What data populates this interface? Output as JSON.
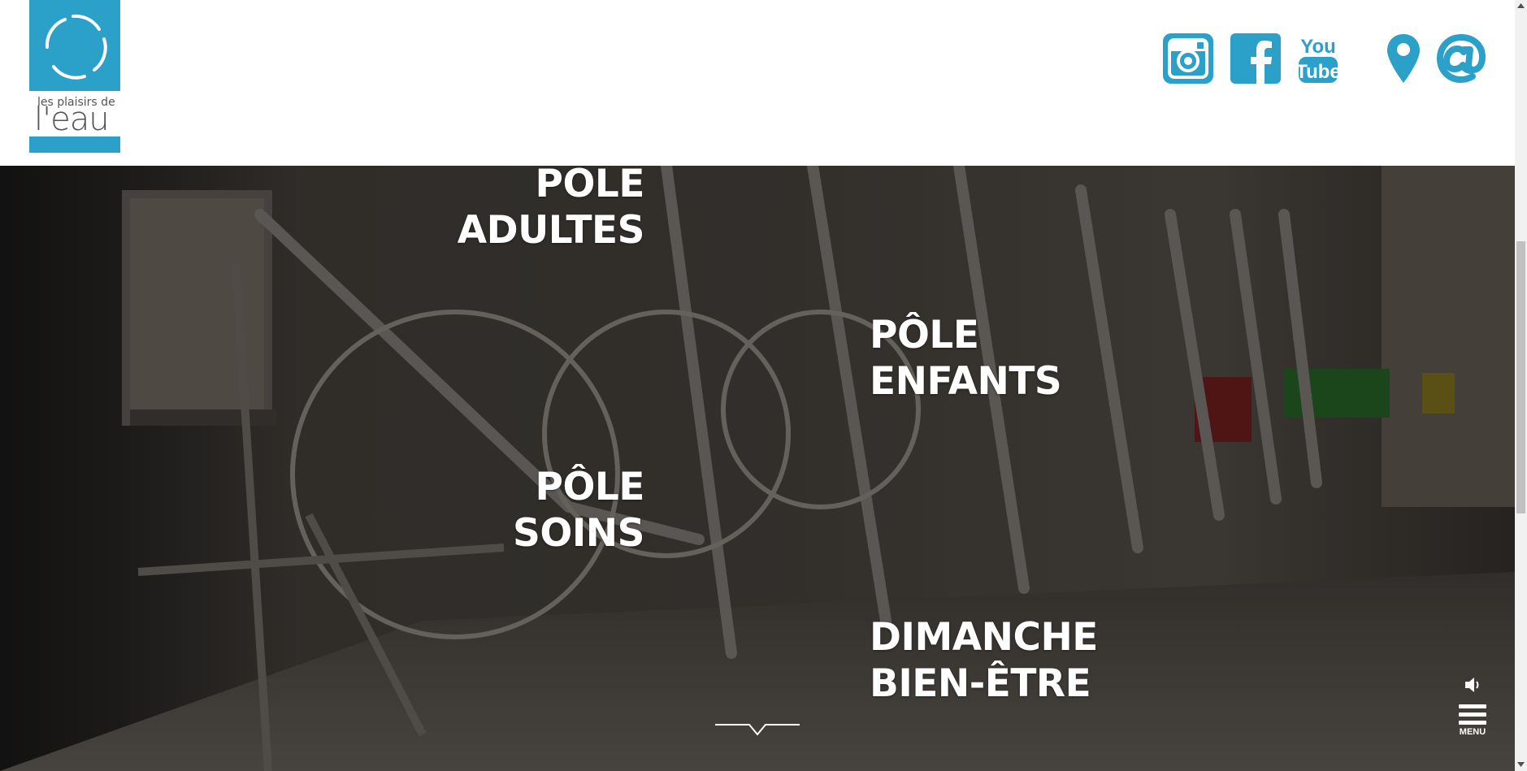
{
  "brand": {
    "logo_small": "les plaisirs de",
    "logo_big": "l'eau",
    "color": "#2ba0c8"
  },
  "social": {
    "instagram": "instagram-icon",
    "facebook": "facebook-icon",
    "youtube_top": "You",
    "youtube_bottom": "Tube",
    "location": "map-pin-icon",
    "email": "at-sign-icon"
  },
  "hero": {
    "adultes": {
      "line1": "PÔLE",
      "line2": "ADULTES"
    },
    "enfants": {
      "line1": "PÔLE",
      "line2": "ENFANTS"
    },
    "soins": {
      "line1": "PÔLE",
      "line2": "SOINS"
    },
    "dimanche": {
      "line1": "DIMANCHE",
      "line2": "BIEN-ÊTRE"
    }
  },
  "menu": {
    "label": "MENU"
  }
}
